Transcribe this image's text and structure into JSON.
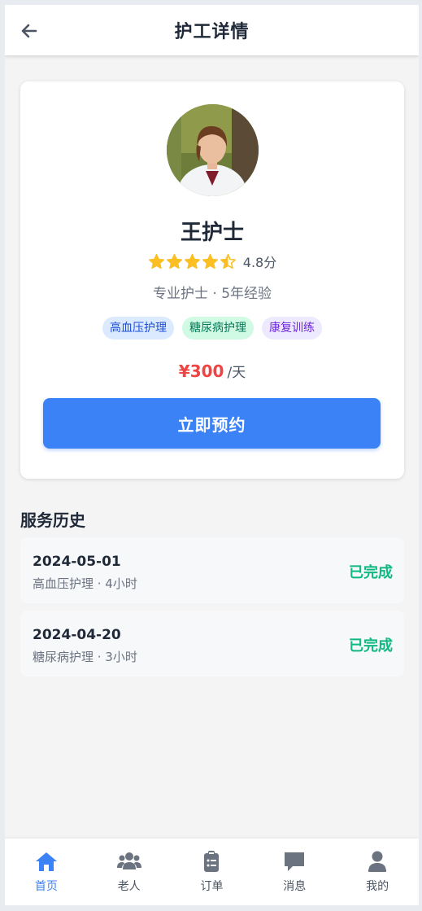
{
  "header": {
    "title": "护工详情",
    "back_icon": "arrow-left-icon"
  },
  "caregiver": {
    "name": "王护士",
    "rating_value": 4.5,
    "rating_text": "4.8分",
    "meta": "专业护士 · 5年经验",
    "tags": [
      "高血压护理",
      "糖尿病护理",
      "康复训练"
    ],
    "price": "¥300",
    "price_unit": "/天",
    "book_label": "立即预约"
  },
  "history": {
    "title": "服务历史",
    "items": [
      {
        "date": "2024-05-01",
        "desc": "高血压护理 · 4小时",
        "status": "已完成"
      },
      {
        "date": "2024-04-20",
        "desc": "糖尿病护理 · 3小时",
        "status": "已完成"
      }
    ]
  },
  "tabbar": {
    "items": [
      {
        "label": "首页",
        "icon": "home-icon",
        "active": true
      },
      {
        "label": "老人",
        "icon": "users-icon",
        "active": false
      },
      {
        "label": "订单",
        "icon": "clipboard-icon",
        "active": false
      },
      {
        "label": "消息",
        "icon": "message-icon",
        "active": false
      },
      {
        "label": "我的",
        "icon": "user-icon",
        "active": false
      }
    ]
  },
  "colors": {
    "accent": "#3b82f6",
    "price": "#ef4444",
    "success": "#10b981",
    "star": "#fbbf24"
  }
}
